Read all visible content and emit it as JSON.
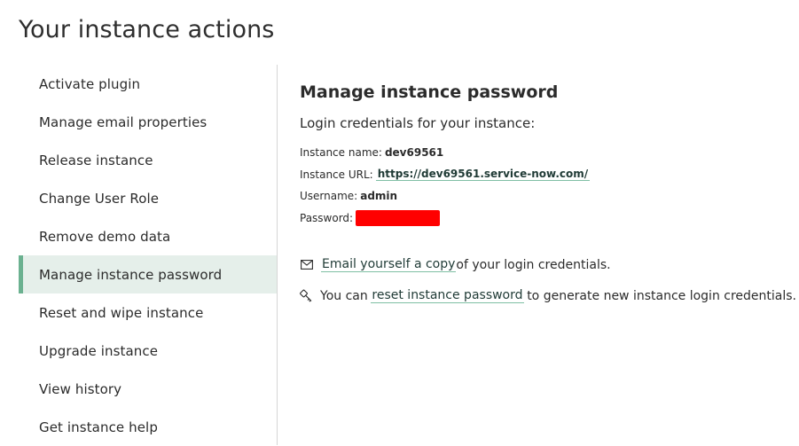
{
  "page": {
    "title": "Your instance actions"
  },
  "sidebar": {
    "items": [
      {
        "label": "Activate plugin"
      },
      {
        "label": "Manage email properties"
      },
      {
        "label": "Release instance"
      },
      {
        "label": "Change User Role"
      },
      {
        "label": "Remove demo data"
      },
      {
        "label": "Manage instance password",
        "active": true
      },
      {
        "label": "Reset and wipe instance"
      },
      {
        "label": "Upgrade instance"
      },
      {
        "label": "View history"
      },
      {
        "label": "Get instance help"
      }
    ]
  },
  "panel": {
    "title": "Manage instance password",
    "intro": "Login credentials for your instance:",
    "instance_name_label": "Instance name:",
    "instance_name_value": "dev69561",
    "instance_url_label": "Instance URL:",
    "instance_url_value": "https://dev69561.service-now.com/",
    "username_label": "Username:",
    "username_value": "admin",
    "password_label": "Password:",
    "email_link": "Email yourself a copy",
    "email_suffix": "of your login credentials.",
    "reset_prefix": "You can",
    "reset_link": "reset instance password",
    "reset_suffix": "to generate new instance login credentials."
  },
  "icons": {
    "email": "envelope-icon",
    "reset": "key-icon"
  },
  "colors": {
    "active_bg": "#e5efea",
    "active_accent": "#6bb190",
    "link_underline": "#7fbfa4",
    "password_mask": "#ff0000"
  }
}
